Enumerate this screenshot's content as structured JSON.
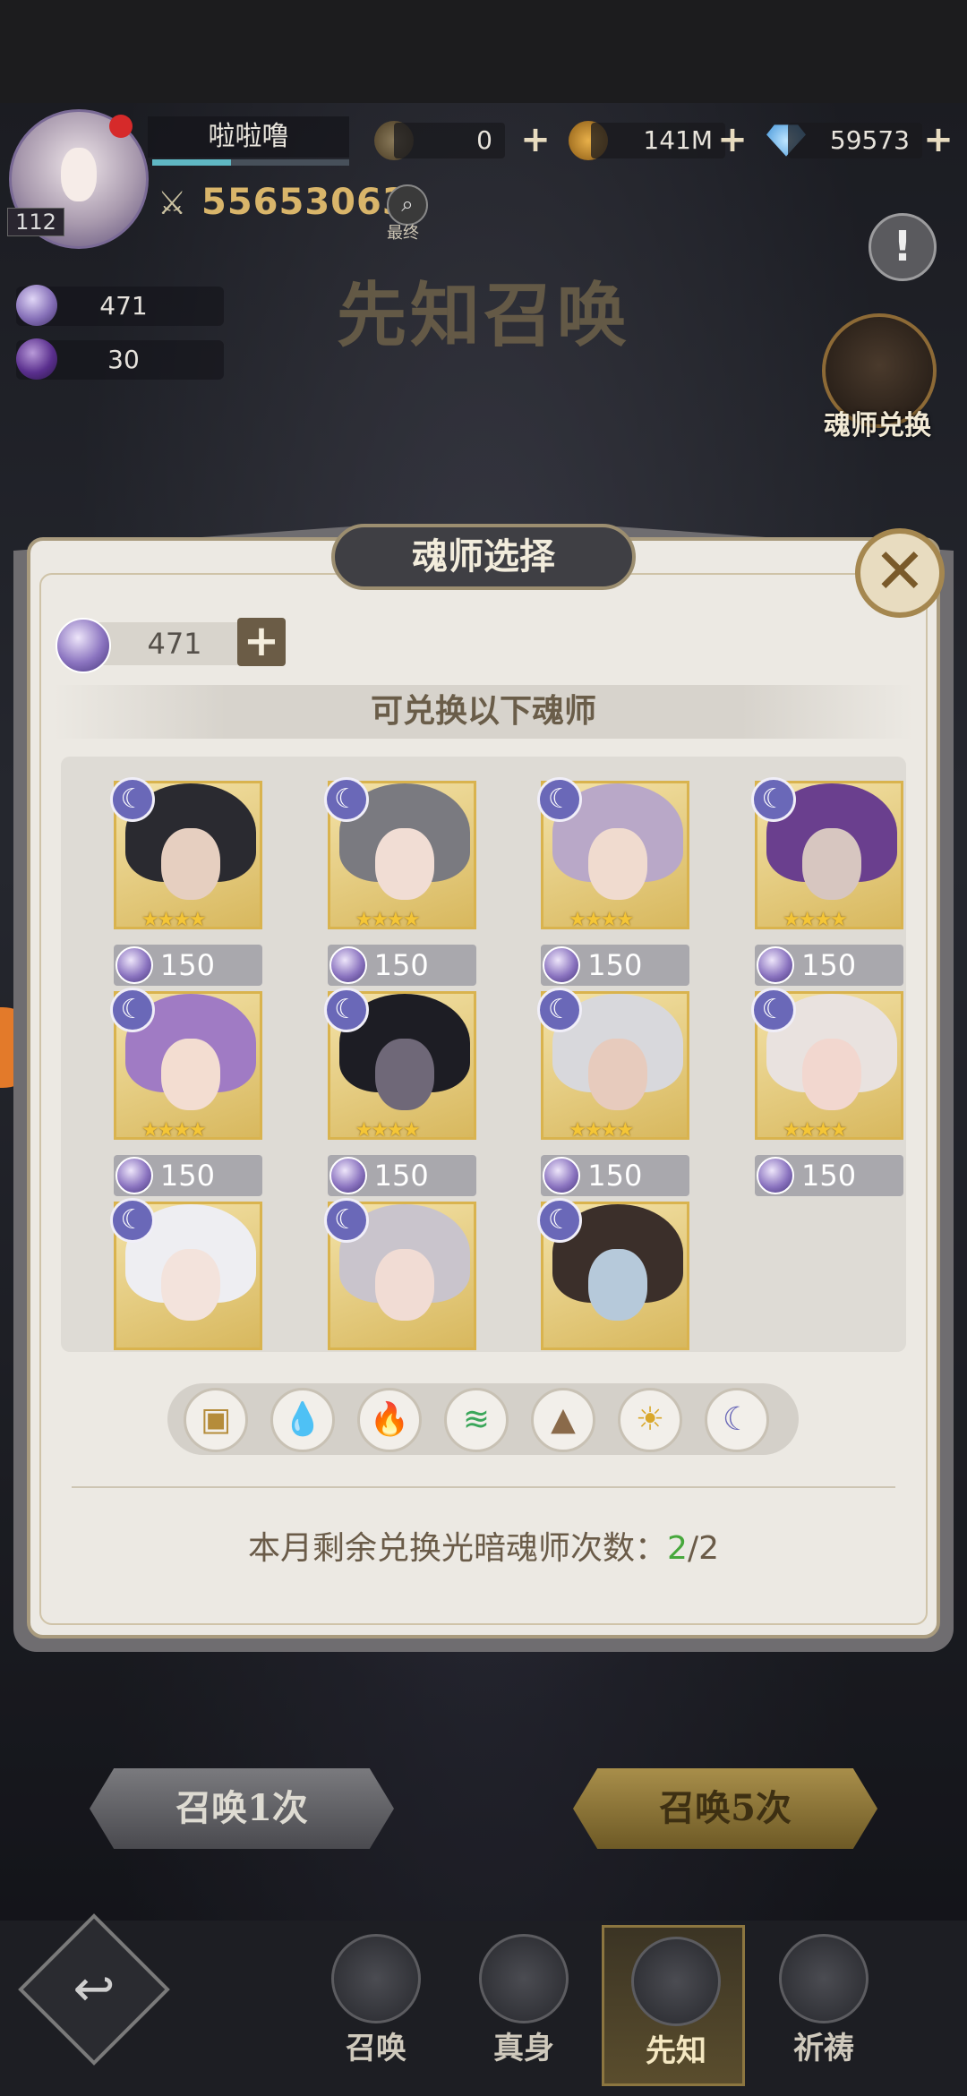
{
  "hud": {
    "player_name": "啦啦噜",
    "level": "112",
    "resources": [
      {
        "name": "coupon",
        "value": "0"
      },
      {
        "name": "gold",
        "value": "141M"
      },
      {
        "name": "diamond",
        "value": "59573"
      }
    ],
    "combat_power": "55653063",
    "final_label": "最终",
    "currencies": [
      {
        "name": "soul-orb",
        "value": "471"
      },
      {
        "name": "dark-orb",
        "value": "30"
      }
    ],
    "banner_title": "先知召唤",
    "info_label": "!",
    "exchange_label": "魂师兑换"
  },
  "modal": {
    "title": "魂师选择",
    "close_label": "✕",
    "balance": "471",
    "plus_label": "+",
    "subtitle": "可兑换以下魂师",
    "cards": [
      {
        "element": "dark",
        "stars": 4,
        "cost": "150",
        "hair": "#2a2a30",
        "face": "#e6cfc0"
      },
      {
        "element": "dark",
        "stars": 4,
        "cost": "150",
        "hair": "#7a7a80",
        "face": "#f1ddd4"
      },
      {
        "element": "dark",
        "stars": 4,
        "cost": "150",
        "hair": "#b9a8c8",
        "face": "#f0dbcf"
      },
      {
        "element": "dark",
        "stars": 4,
        "cost": "150",
        "hair": "#6a3f8e",
        "face": "#d7c6c0"
      },
      {
        "element": "dark",
        "stars": 4,
        "cost": "150",
        "hair": "#a07bc4",
        "face": "#f3ddd1"
      },
      {
        "element": "dark",
        "stars": 4,
        "cost": "150",
        "hair": "#1d1d24",
        "face": "#6f6878"
      },
      {
        "element": "dark",
        "stars": 4,
        "cost": "150",
        "hair": "#d8d8dc",
        "face": "#e7cbbd"
      },
      {
        "element": "dark",
        "stars": 4,
        "cost": "150",
        "hair": "#e9e2df",
        "face": "#f2d7cf"
      },
      {
        "element": "dark",
        "stars": 0,
        "cost": "",
        "hair": "#eeeef2",
        "face": "#f3e3dc"
      },
      {
        "element": "dark",
        "stars": 0,
        "cost": "",
        "hair": "#c9c4cc",
        "face": "#f1dcd4"
      },
      {
        "element": "dark",
        "stars": 0,
        "cost": "",
        "hair": "#3b2f2a",
        "face": "#b6c9da"
      }
    ],
    "elements": [
      {
        "name": "all",
        "glyph": "▣",
        "color": "#b58c3a"
      },
      {
        "name": "water",
        "glyph": "💧",
        "color": "#3b8fd6"
      },
      {
        "name": "fire",
        "glyph": "🔥",
        "color": "#d9442f"
      },
      {
        "name": "wind",
        "glyph": "≋",
        "color": "#3aa65a"
      },
      {
        "name": "earth",
        "glyph": "▲",
        "color": "#8a6a4a"
      },
      {
        "name": "light",
        "glyph": "☀",
        "color": "#d9a72a"
      },
      {
        "name": "dark",
        "glyph": "☾",
        "color": "#6a68b8"
      }
    ],
    "footer_prefix": "本月剩余兑换光暗魂师次数：",
    "footer_remaining": "2",
    "footer_total": "/2"
  },
  "bottom": {
    "summon_once": "召唤1次",
    "summon_five": "召唤5次",
    "nav": [
      {
        "label": "召唤",
        "active": false
      },
      {
        "label": "真身",
        "active": false
      },
      {
        "label": "先知",
        "active": true
      },
      {
        "label": "祈祷",
        "active": false
      }
    ]
  }
}
